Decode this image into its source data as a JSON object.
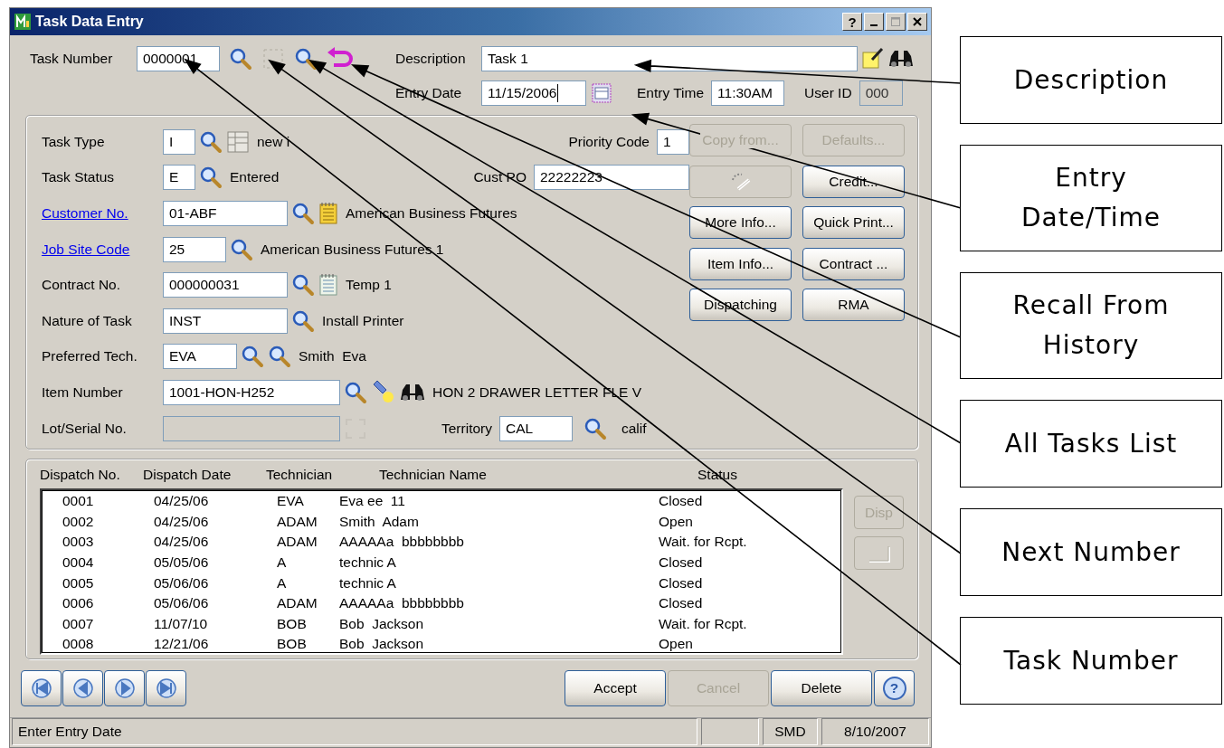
{
  "window": {
    "title": "Task Data Entry",
    "help_button": "?"
  },
  "header": {
    "task_number": {
      "label": "Task Number",
      "value": "0000001"
    },
    "description": {
      "label": "Description",
      "value": "Task 1"
    },
    "entry_date": {
      "label": "Entry Date",
      "value": "11/15/2006",
      "focused": true
    },
    "entry_time": {
      "label": "Entry Time",
      "value": "11:30AM"
    },
    "user_id": {
      "label": "User ID",
      "value": "000",
      "disabled": true
    }
  },
  "form": {
    "rows": [
      {
        "label": "Task Type",
        "kind": "text",
        "field": {
          "value": "I",
          "disabled": false
        },
        "info": "new i",
        "side": {
          "label": "Priority Code",
          "value": "1"
        }
      },
      {
        "label": "Task Status",
        "kind": "text",
        "field": {
          "value": "E",
          "disabled": false
        },
        "info": "Entered",
        "side": {
          "label": "Cust PO",
          "value": "22222223"
        }
      },
      {
        "label": "Customer No.",
        "kind": "link",
        "field": {
          "value": "01-ABF",
          "disabled": false
        },
        "info": "American Business Futures"
      },
      {
        "label": "Job Site Code",
        "kind": "link",
        "field": {
          "value": "25",
          "disabled": false
        },
        "info": "American Business Futures 1"
      },
      {
        "label": "Contract No.",
        "kind": "text",
        "field": {
          "value": "000000031",
          "disabled": false
        },
        "info": "Temp 1"
      },
      {
        "label": "Nature of Task",
        "kind": "text",
        "field": {
          "value": "INST",
          "disabled": false
        },
        "info": "Install Printer"
      },
      {
        "label": "Preferred Tech.",
        "kind": "text",
        "field": {
          "value": "EVA",
          "disabled": false
        },
        "info": "Smith  Eva"
      },
      {
        "label": "Item Number",
        "kind": "text",
        "field": {
          "value": "1001-HON-H252",
          "disabled": false
        },
        "info": "HON 2 DRAWER LETTER FLE V"
      },
      {
        "label": "Lot/Serial No.",
        "kind": "text",
        "field": {
          "disabled": true
        },
        "side": {
          "label": "Territory",
          "value": "CAL",
          "info": "calif"
        }
      }
    ],
    "buttons": [
      {
        "kind": "text",
        "label": "Copy from...",
        "disabled": true
      },
      {
        "kind": "text",
        "label": "Defaults...",
        "disabled": true
      },
      {
        "kind": "icon",
        "disabled": true
      },
      {
        "kind": "text",
        "label": "Credit...",
        "disabled": false
      },
      {
        "kind": "text",
        "label": "More Info...",
        "disabled": false
      },
      {
        "kind": "text",
        "label": "Quick Print...",
        "disabled": false
      },
      {
        "kind": "text",
        "label": "Item Info...",
        "disabled": false
      },
      {
        "kind": "text",
        "label": "Contract ...",
        "disabled": false
      },
      {
        "kind": "text",
        "label": "Dispatching",
        "disabled": false
      },
      {
        "kind": "text",
        "label": "RMA",
        "disabled": false
      }
    ]
  },
  "dispatches": {
    "columns": [
      "Dispatch No.",
      "Dispatch Date",
      "Technician",
      "Technician Name",
      "Status"
    ],
    "rows": [
      [
        "0001",
        "04/25/06",
        "EVA",
        "Eva ee  11",
        "Closed"
      ],
      [
        "0002",
        "04/25/06",
        "ADAM",
        "Smith  Adam",
        "Open"
      ],
      [
        "0003",
        "04/25/06",
        "ADAM",
        "AAAAAa  bbbbbbbb",
        "Wait. for Rcpt."
      ],
      [
        "0004",
        "05/05/06",
        "A",
        "technic A",
        "Closed"
      ],
      [
        "0005",
        "05/06/06",
        "A",
        "technic A",
        "Closed"
      ],
      [
        "0006",
        "05/06/06",
        "ADAM",
        "AAAAAa  bbbbbbbb",
        "Closed"
      ],
      [
        "0007",
        "11/07/10",
        "BOB",
        "Bob  Jackson",
        "Wait. for Rcpt."
      ],
      [
        "0008",
        "12/21/06",
        "BOB",
        "Bob  Jackson",
        "Open"
      ]
    ],
    "buttons": [
      {
        "kind": "text",
        "label": "Disp",
        "disabled": true
      },
      {
        "kind": "icon",
        "disabled": true
      }
    ]
  },
  "actions": [
    {
      "kind": "text",
      "label": "Accept",
      "disabled": false
    },
    {
      "kind": "text",
      "label": "Cancel",
      "disabled": true
    },
    {
      "kind": "text",
      "label": "Delete",
      "disabled": false
    },
    {
      "kind": "help",
      "label": "?",
      "disabled": false
    }
  ],
  "status_bar": [
    "Enter Entry Date",
    "SMD",
    "8/10/2007"
  ],
  "callouts": [
    {
      "text": "Description"
    },
    {
      "text": "Entry\nDate/Time"
    },
    {
      "text": "Recall From\nHistory"
    },
    {
      "text": "All Tasks List"
    },
    {
      "text": "Next Number"
    },
    {
      "text": "Task Number"
    }
  ]
}
